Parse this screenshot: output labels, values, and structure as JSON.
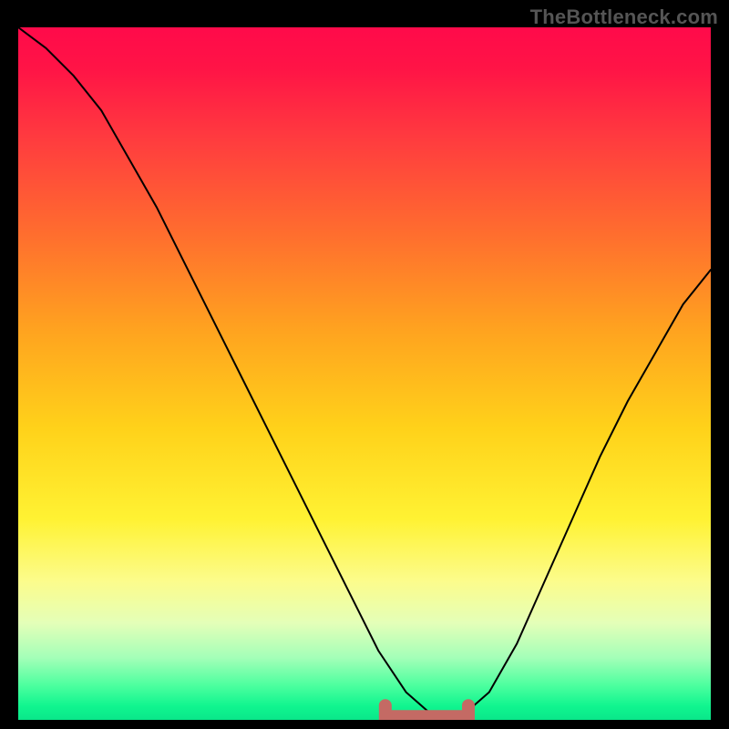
{
  "watermark": "TheBottleneck.com",
  "colors": {
    "frame": "#000000",
    "gradient_top": "#ff0a4a",
    "gradient_bottom": "#0ae78a",
    "curve": "#000000",
    "marker": "#c46a64"
  },
  "chart_data": {
    "type": "line",
    "title": "",
    "xlabel": "",
    "ylabel": "",
    "xlim": [
      0,
      100
    ],
    "ylim": [
      0,
      100
    ],
    "background": "rainbow-gradient",
    "series": [
      {
        "name": "bottleneck-curve",
        "x": [
          0,
          4,
          8,
          12,
          16,
          20,
          24,
          28,
          32,
          36,
          40,
          44,
          48,
          52,
          56,
          60,
          64,
          68,
          72,
          76,
          80,
          84,
          88,
          92,
          96,
          100
        ],
        "y": [
          100,
          97,
          93,
          88,
          81,
          74,
          66,
          58,
          50,
          42,
          34,
          26,
          18,
          10,
          4,
          0.5,
          0.5,
          4,
          11,
          20,
          29,
          38,
          46,
          53,
          60,
          65
        ]
      }
    ],
    "flat_region": {
      "x_start": 54,
      "x_end": 64,
      "y": 0.5
    },
    "annotations": [
      {
        "name": "optimal-range-marker",
        "x_start": 53,
        "x_end": 65,
        "y": 0.5,
        "style": "thick-pink-bar"
      }
    ]
  }
}
